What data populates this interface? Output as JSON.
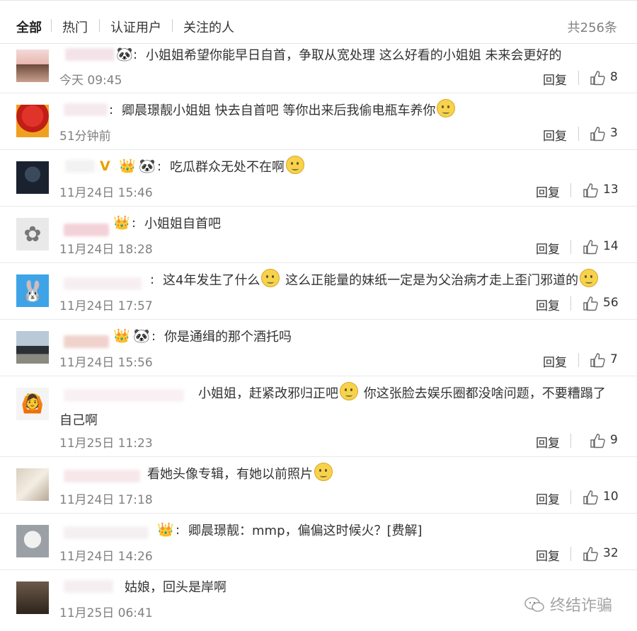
{
  "tabs": {
    "all": "全部",
    "hot": "热门",
    "verified": "认证用户",
    "following": "关注的人",
    "total": "共256条"
  },
  "reply_label": "回复",
  "comments": [
    {
      "text": "小姐姐希望你能早日自首，争取从宽处理   这么好看的小姐姐  未来会更好的",
      "time": "今天 09:45",
      "likes": "8"
    },
    {
      "text": "卿晨璟靓小姐姐 快去自首吧 等你出来后我偷电瓶车养你",
      "time": "51分钟前",
      "likes": "3"
    },
    {
      "text": "吃瓜群众无处不在啊",
      "time": "11月24日 15:46",
      "likes": "13"
    },
    {
      "text": "小姐姐自首吧",
      "time": "11月24日 18:28",
      "likes": "14"
    },
    {
      "text": "这4年发生了什么",
      "text_b": " 这么正能量的妹纸一定是为父治病才走上歪门邪道的",
      "time": "11月24日 17:57",
      "likes": "56"
    },
    {
      "text": "你是通缉的那个酒托吗",
      "time": "11月24日 15:56",
      "likes": "7"
    },
    {
      "text": "小姐姐，赶紧改邪归正吧",
      "text_b": " 你这张脸去娱乐圈都没啥问题，不要糟蹋了",
      "text2": "自己啊",
      "time": "11月25日 11:23",
      "likes": "9"
    },
    {
      "text": "看她头像专辑，有她以前照片",
      "time": "11月24日 17:18",
      "likes": "10"
    },
    {
      "text": "卿晨璟靓：mmp，偏偏这时候火？[费解]",
      "time": "11月24日 14:26",
      "likes": "32"
    },
    {
      "text": "姑娘，回头是岸啊",
      "time": "11月25日 06:41",
      "likes": ""
    }
  ],
  "badges": {
    "vip": "V"
  },
  "watermark": "终结诈骗",
  "colors": {
    "accent": "#333333",
    "muted": "#808080",
    "divider": "#e9e9e9"
  }
}
